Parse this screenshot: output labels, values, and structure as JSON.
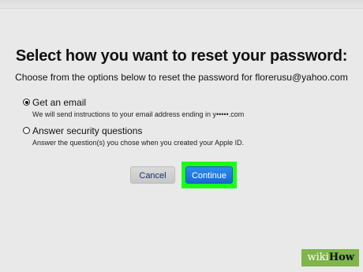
{
  "header": {
    "title": "Select how you want to reset your password:",
    "subtitle": "Choose from the options below to reset the password for florerusu@yahoo.com"
  },
  "options": [
    {
      "label": "Get an email",
      "description": "We will send instructions to your email address ending in y•••••.com",
      "selected": true
    },
    {
      "label": "Answer security questions",
      "description": "Answer the question(s) you chose when you created your Apple ID.",
      "selected": false
    }
  ],
  "buttons": {
    "cancel_label": "Cancel",
    "continue_label": "Continue"
  },
  "watermark": {
    "wiki": "wiki",
    "how": "How"
  },
  "colors": {
    "highlight": "#1aff1a",
    "primary_button": "#1f78df",
    "background": "#e9e9e9"
  }
}
